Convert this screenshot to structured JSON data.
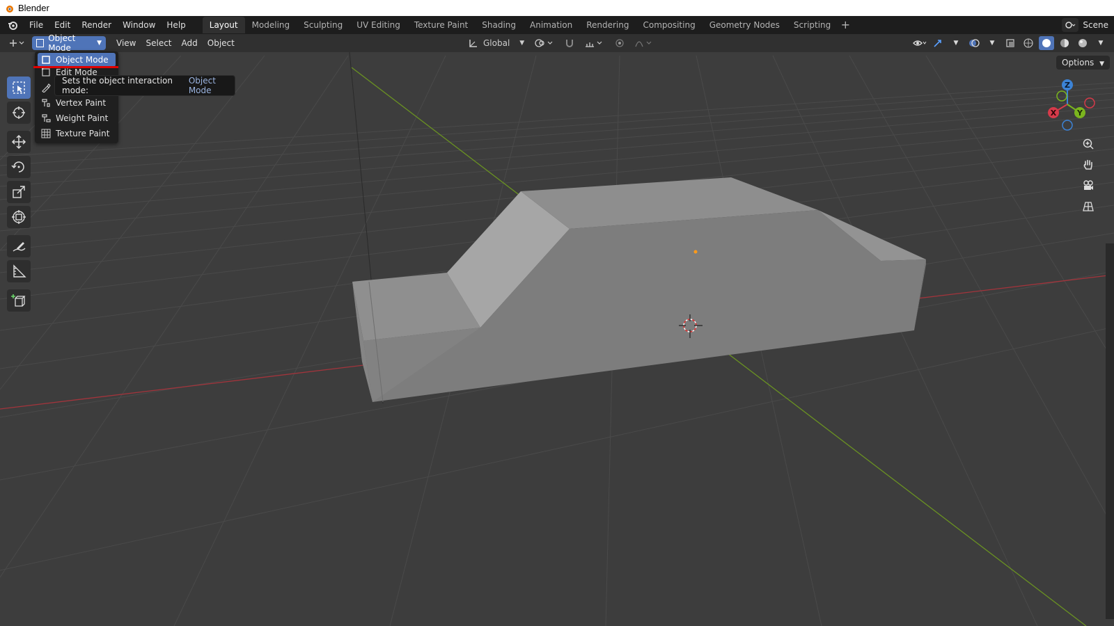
{
  "window": {
    "title": "Blender"
  },
  "menubar": {
    "items": [
      "File",
      "Edit",
      "Render",
      "Window",
      "Help"
    ],
    "workspaces": [
      "Layout",
      "Modeling",
      "Sculpting",
      "UV Editing",
      "Texture Paint",
      "Shading",
      "Animation",
      "Rendering",
      "Compositing",
      "Geometry Nodes",
      "Scripting"
    ],
    "active_workspace": "Layout",
    "add_label": "+",
    "scene_label": "Scene"
  },
  "header3d": {
    "mode_label": "Object Mode",
    "menus": [
      "View",
      "Select",
      "Add",
      "Object"
    ],
    "orientation": "Global",
    "options_label": "Options"
  },
  "mode_dropdown": {
    "items": [
      {
        "label": "Object Mode",
        "icon": "object-mode-icon",
        "selected": true
      },
      {
        "label": "Edit Mode",
        "icon": "edit-mode-icon",
        "selected": false
      },
      {
        "label": "Sculpt Mode",
        "icon": "sculpt-mode-icon",
        "selected": false
      },
      {
        "label": "Vertex Paint",
        "icon": "vertex-paint-icon",
        "selected": false
      },
      {
        "label": "Weight Paint",
        "icon": "weight-paint-icon",
        "selected": false
      },
      {
        "label": "Texture Paint",
        "icon": "texture-paint-icon",
        "selected": false
      }
    ]
  },
  "tooltip": {
    "text": "Sets the object interaction mode:",
    "value": "Object Mode"
  },
  "toolbar": {
    "tools": [
      "select-box-icon",
      "cursor-icon",
      "move-icon",
      "rotate-icon",
      "scale-icon",
      "transform-icon",
      "annotate-icon",
      "measure-icon",
      "add-cube-icon"
    ],
    "active_tool": "select-box-icon"
  },
  "gizmo": {
    "x_label": "X",
    "y_label": "Y",
    "z_label": "Z"
  },
  "colors": {
    "accent": "#4f74b8",
    "x_axis": "#d63a4a",
    "y_axis": "#7bb51e",
    "z_axis": "#3c83d6",
    "viewport_bg": "#3d3d3d",
    "highlight_underline": "#e00000"
  }
}
